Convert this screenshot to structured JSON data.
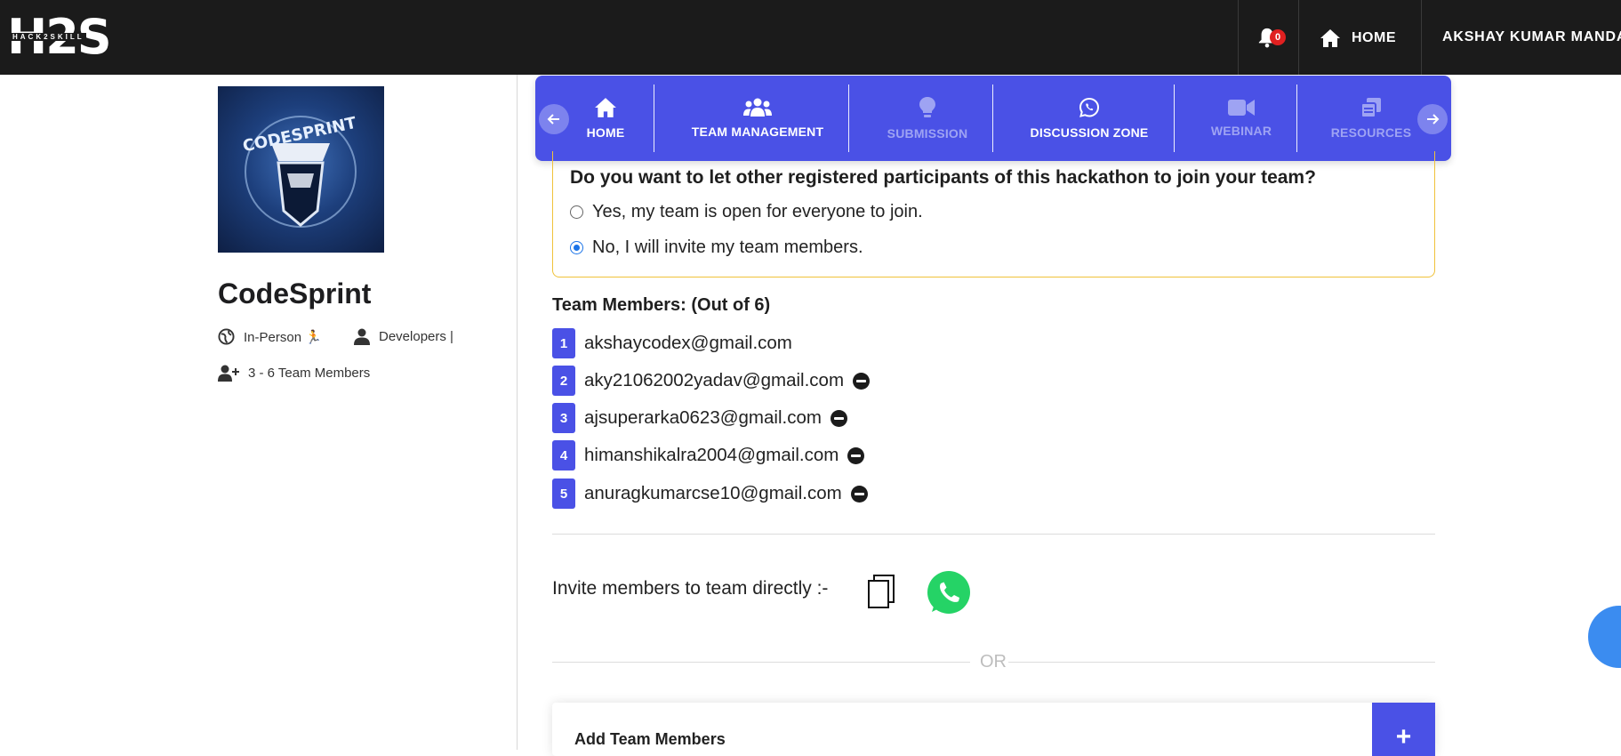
{
  "brand": {
    "logo_main": "H2S",
    "logo_sub": "HACK2SKILL"
  },
  "topnav": {
    "notification_count": "0",
    "home_label": "HOME",
    "user_name": "AKSHAY KUMAR MANDAL"
  },
  "event": {
    "title": "CodeSprint",
    "mode": "In-Person 🏃",
    "audience": "Developers |",
    "team_size": "3 - 6 Team Members"
  },
  "tabs": [
    {
      "label": "HOME",
      "icon": "home-icon",
      "enabled": true
    },
    {
      "label": "TEAM MANAGEMENT",
      "icon": "users-icon",
      "enabled": true
    },
    {
      "label": "SUBMISSION",
      "icon": "lightbulb-icon",
      "enabled": false
    },
    {
      "label": "DISCUSSION ZONE",
      "icon": "whatsapp-icon",
      "enabled": true
    },
    {
      "label": "WEBINAR",
      "icon": "video-icon",
      "enabled": false
    },
    {
      "label": "RESOURCES",
      "icon": "copy-icon",
      "enabled": false
    }
  ],
  "team_pref": {
    "question": "Do you want to let other registered participants of this hackathon to join your team?",
    "options": [
      {
        "label": "Yes, my team is open for everyone to join.",
        "selected": false
      },
      {
        "label": "No, I will invite my team members.",
        "selected": true
      }
    ]
  },
  "members": {
    "title": "Team Members: (Out of 6)",
    "list": [
      {
        "num": "1",
        "email": "akshaycodex@gmail.com",
        "removable": false
      },
      {
        "num": "2",
        "email": "aky21062002yadav@gmail.com",
        "removable": true
      },
      {
        "num": "3",
        "email": "ajsuperarka0623@gmail.com",
        "removable": true
      },
      {
        "num": "4",
        "email": "himanshikalra2004@gmail.com",
        "removable": true
      },
      {
        "num": "5",
        "email": "anuragkumarcse10@gmail.com",
        "removable": true
      }
    ]
  },
  "invite": {
    "label": "Invite members to team directly :-",
    "or_text": "OR"
  },
  "add_members": {
    "title": "Add Team Members",
    "button": "+"
  },
  "colors": {
    "accent": "#4a51e6",
    "topbar": "#1b1b1b",
    "pref_border": "#f0c23a",
    "whatsapp": "#25d366"
  }
}
